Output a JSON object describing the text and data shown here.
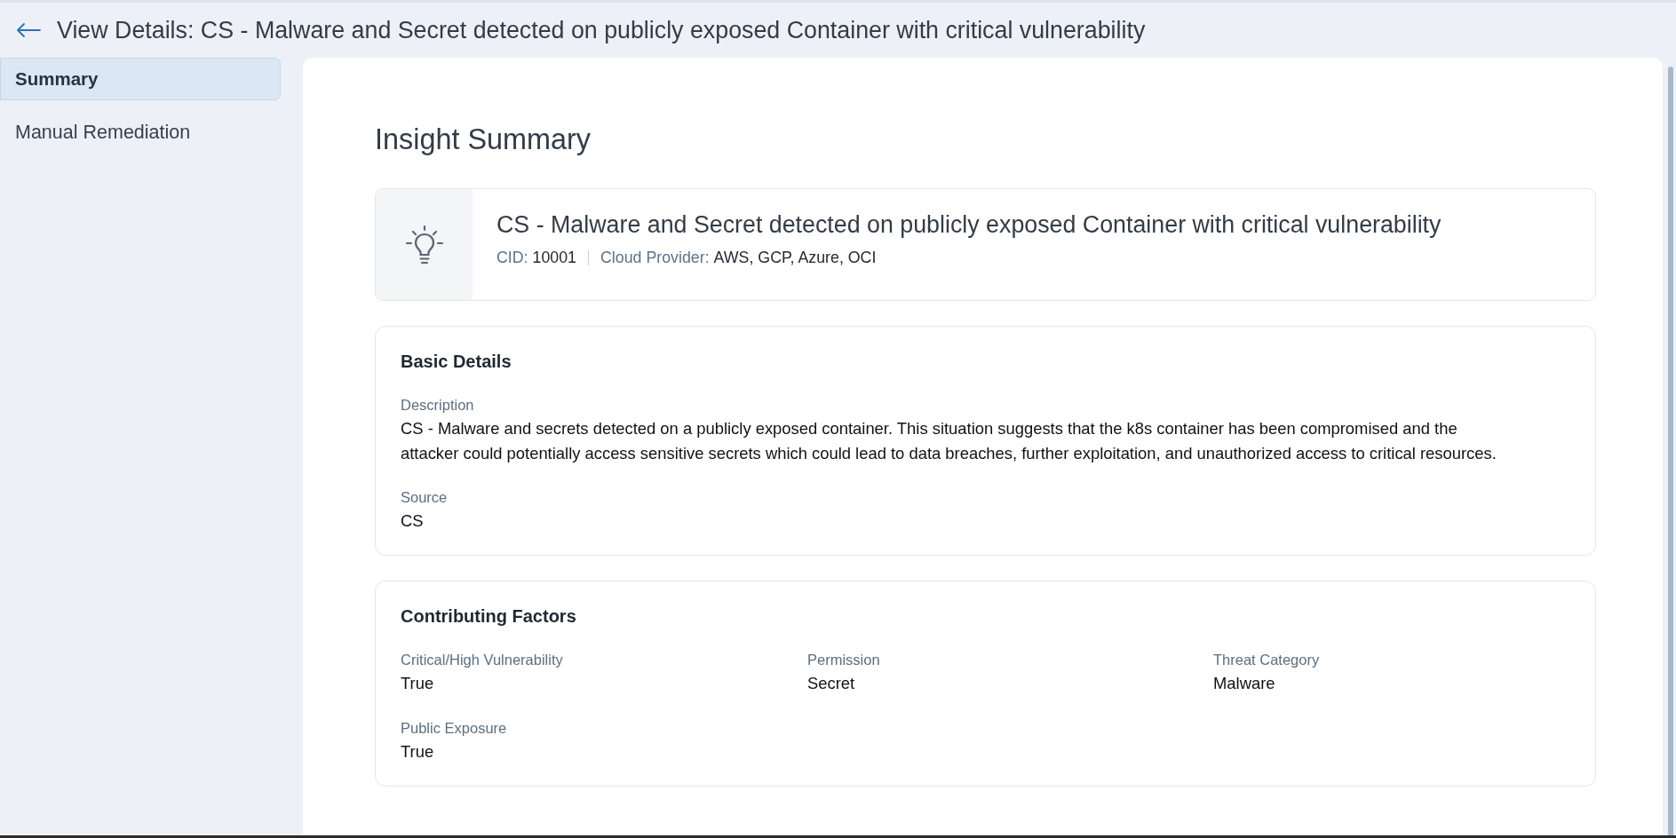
{
  "header": {
    "title": "View Details: CS - Malware and Secret detected on publicly exposed Container with critical vulnerability"
  },
  "sidebar": {
    "items": [
      {
        "label": "Summary",
        "selected": true
      },
      {
        "label": "Manual Remediation",
        "selected": false
      }
    ]
  },
  "main": {
    "title": "Insight Summary",
    "insight": {
      "title": "CS - Malware and Secret detected on publicly exposed Container with critical vulnerability",
      "meta": [
        {
          "label": "CID:",
          "value": "10001"
        },
        {
          "label": "Cloud Provider:",
          "value": "AWS, GCP, Azure, OCI"
        }
      ]
    },
    "basic_details": {
      "title": "Basic Details",
      "fields": [
        {
          "label": "Description",
          "value": "CS - Malware and secrets detected on a publicly exposed container. This situation suggests that the k8s container has been compromised and the attacker could potentially access sensitive secrets which could lead to data breaches, further exploitation, and unauthorized access to critical resources."
        },
        {
          "label": "Source",
          "value": "CS"
        }
      ]
    },
    "contributing_factors": {
      "title": "Contributing Factors",
      "fields": [
        {
          "label": "Critical/High Vulnerability",
          "value": "True"
        },
        {
          "label": "Permission",
          "value": "Secret"
        },
        {
          "label": "Threat Category",
          "value": "Malware"
        },
        {
          "label": "Public Exposure",
          "value": "True"
        }
      ]
    }
  }
}
